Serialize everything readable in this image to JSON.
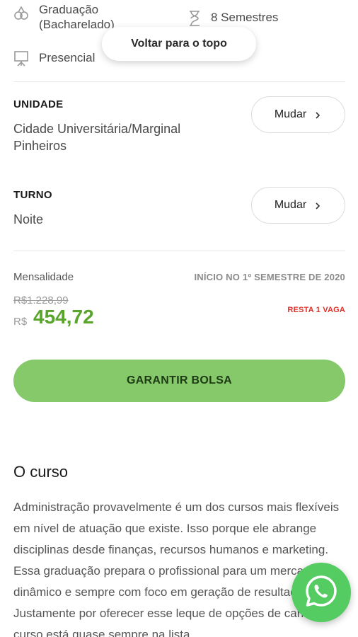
{
  "course_info": {
    "degree": "Graduação (Bacharelado)",
    "duration": "8 Semestres",
    "modality": "Presencial"
  },
  "toast": {
    "label": "Voltar para o topo"
  },
  "unit": {
    "label": "UNIDADE",
    "value": "Cidade Universitária/Marginal Pinheiros",
    "change_label": "Mudar"
  },
  "shift": {
    "label": "TURNO",
    "value": "Noite",
    "change_label": "Mudar"
  },
  "pricing": {
    "monthly_label": "Mensalidade",
    "start_info": "INÍCIO NO 1º SEMESTRE DE 2020",
    "old_price": "R$1.228,99",
    "currency": "R$",
    "price": "454,72",
    "vacancy": "RESTA 1 VAGA"
  },
  "cta": {
    "label": "GARANTIR BOLSA"
  },
  "course": {
    "title": "O curso",
    "description": "Administração provavelmente é um dos cursos mais flexíveis em nível de atuação que existe. Isso porque ele abrange disciplinas desde finanças, recursos humanos e marketing. Essa graduação prepara o profissional para um mercado dinâmico e sempre com foco em geração de resultados. Justamente por oferecer esse leque de opções de carreira, o curso está quase sempre na lista"
  },
  "colors": {
    "price_green": "#59a42a",
    "cta_green": "#85c96a",
    "vacancy_red": "#e0322b",
    "whatsapp_green": "#54cc62"
  },
  "icons": {
    "degree": "graduation-icon",
    "duration": "hourglass-icon",
    "modality": "presentation-board-icon",
    "chat": "whatsapp-icon"
  }
}
